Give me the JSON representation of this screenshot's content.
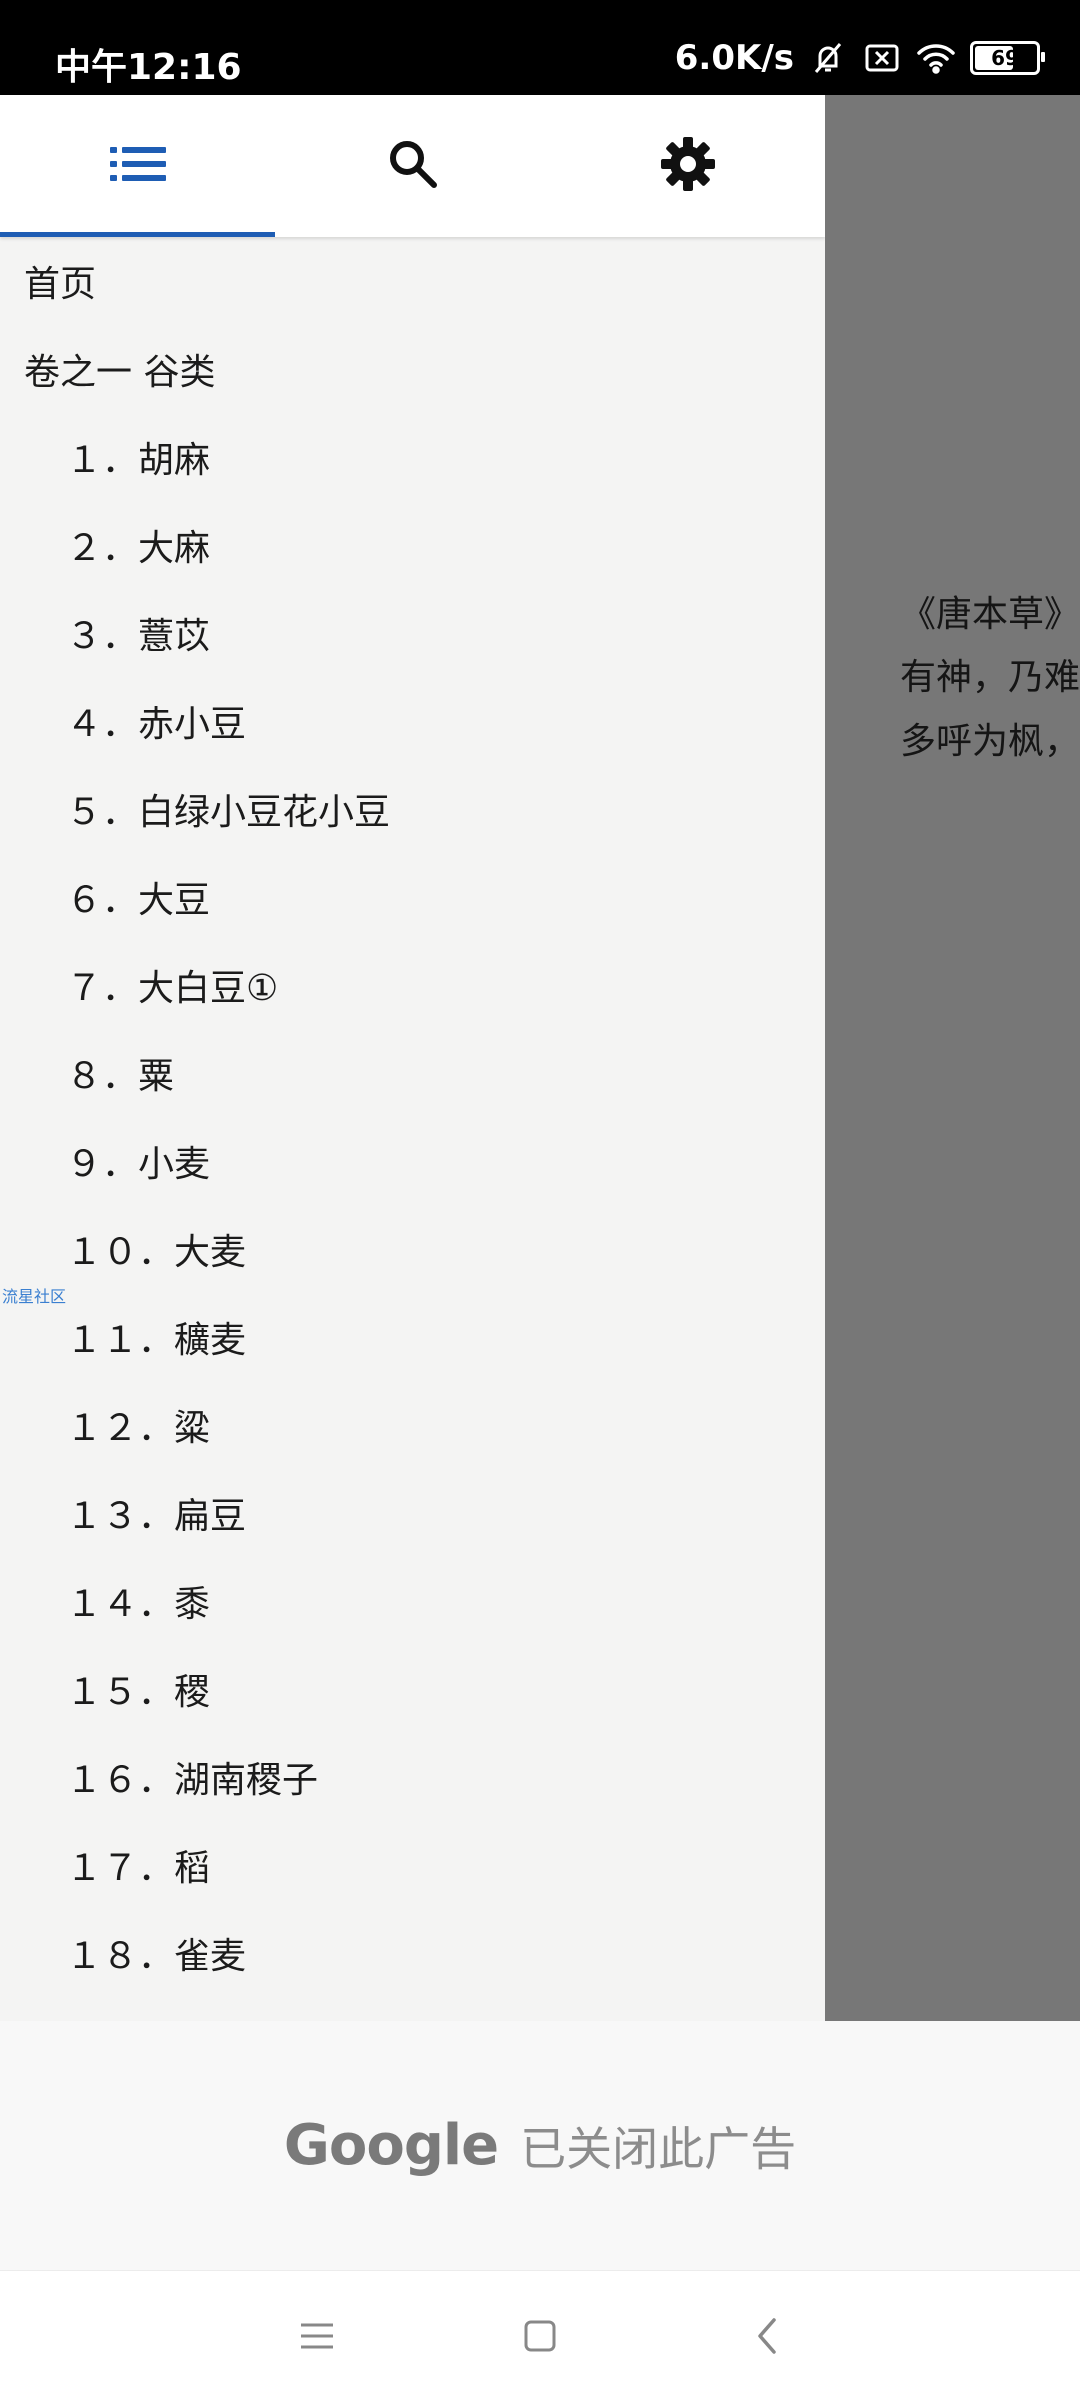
{
  "status_bar": {
    "time": "中午12:16",
    "net_speed": "6.0K/s",
    "battery_level": "69",
    "icons": [
      "bell-off-icon",
      "sim-off-icon",
      "wifi-icon",
      "battery-icon"
    ]
  },
  "background_content": {
    "lines": [
      "《唐本草》",
      "有神，乃难",
      "多呼为枫，"
    ]
  },
  "tabs": [
    {
      "name": "toc",
      "icon": "list-icon",
      "active": true
    },
    {
      "name": "search",
      "icon": "search-icon",
      "active": false
    },
    {
      "name": "settings",
      "icon": "gear-icon",
      "active": false
    }
  ],
  "accent_color": "#1e5db4",
  "toc": {
    "items": [
      {
        "label": "首页",
        "level": 0
      },
      {
        "label": "卷之一 谷类",
        "level": 0
      },
      {
        "label": "１．胡麻",
        "level": 1
      },
      {
        "label": "２．大麻",
        "level": 1
      },
      {
        "label": "３．薏苡",
        "level": 1
      },
      {
        "label": "４．赤小豆",
        "level": 1
      },
      {
        "label": "５．白绿小豆花小豆",
        "level": 1
      },
      {
        "label": "６．大豆",
        "level": 1
      },
      {
        "label": "７．大白豆①",
        "level": 1
      },
      {
        "label": "８．粟",
        "level": 1
      },
      {
        "label": "９．小麦",
        "level": 1
      },
      {
        "label": "１０．大麦",
        "level": 1
      },
      {
        "label": "１１．穬麦",
        "level": 1
      },
      {
        "label": "１２．粱",
        "level": 1
      },
      {
        "label": "１３．扁豆",
        "level": 1
      },
      {
        "label": "１４．黍",
        "level": 1
      },
      {
        "label": "１５．稷",
        "level": 1
      },
      {
        "label": "１６．湖南稷子",
        "level": 1
      },
      {
        "label": "１７．稻",
        "level": 1
      },
      {
        "label": "１８．雀麦",
        "level": 1
      }
    ]
  },
  "watermark": "流星社区",
  "ad": {
    "brand": "Google",
    "text": "已关闭此广告"
  }
}
